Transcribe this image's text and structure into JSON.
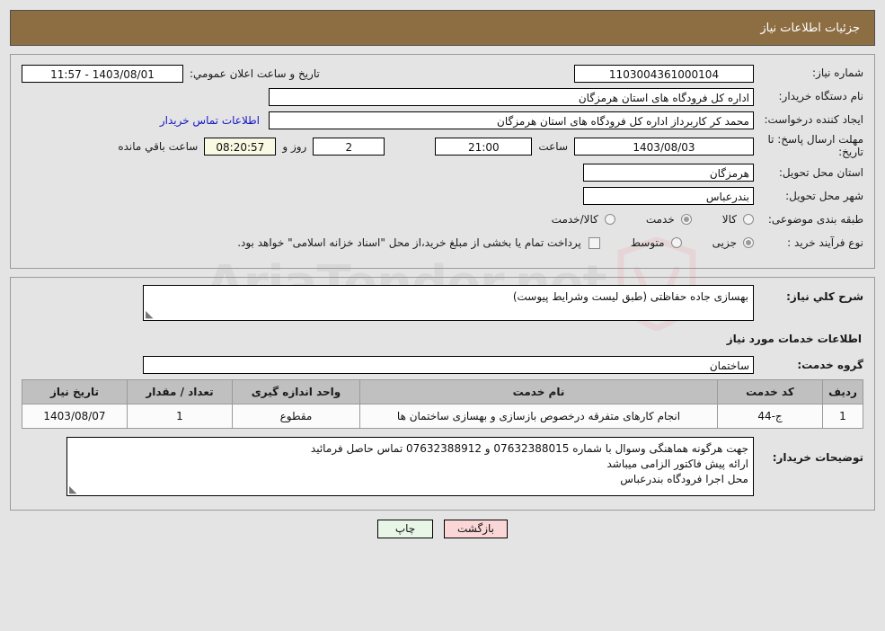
{
  "header": {
    "title": "جزئیات اطلاعات نیاز"
  },
  "watermark": {
    "text": "AriaTender.net",
    "shield_icon": "shield-icon"
  },
  "form": {
    "need_number": {
      "label": "شماره نیاز:",
      "value": "1103004361000104"
    },
    "announce": {
      "label": "تاریخ و ساعت اعلان عمومي:",
      "value": "1403/08/01 - 11:57"
    },
    "buyer_org": {
      "label": "نام دستگاه خریدار:",
      "value": "اداره کل فرودگاه های استان هرمزگان"
    },
    "requester": {
      "label": "ایجاد کننده درخواست:",
      "value": "محمد کر کاربرداز اداره کل فرودگاه های استان هرمزگان"
    },
    "contact_link": {
      "label": "اطلاعات تماس خریدار"
    },
    "deadline": {
      "label": "مهلت ارسال پاسخ: تا تاریخ:",
      "date": "1403/08/03",
      "time_label": "ساعت",
      "time": "21:00",
      "days": "2",
      "days_label": "روز و",
      "countdown": "08:20:57",
      "countdown_label": "ساعت باقي مانده"
    },
    "province": {
      "label": "استان محل تحویل:",
      "value": "هرمزگان"
    },
    "city": {
      "label": "شهر محل تحویل:",
      "value": "بندرعباس"
    },
    "category": {
      "label": "طبقه بندی موضوعی:",
      "options": [
        {
          "label": "کالا",
          "checked": false
        },
        {
          "label": "خدمت",
          "checked": true
        },
        {
          "label": "کالا/خدمت",
          "checked": false
        }
      ]
    },
    "purchase_type": {
      "label": "نوع فرآیند خرید :",
      "options": [
        {
          "label": "جزیی",
          "checked": true
        },
        {
          "label": "متوسط",
          "checked": false
        }
      ],
      "note_checked": false,
      "note": "پرداخت تمام یا بخشی از مبلغ خرید،از محل \"اسناد خزانه اسلامی\" خواهد بود."
    }
  },
  "description": {
    "label": "شرح کلي نیاز:",
    "value": "بهسازی جاده حفاظتی (طبق لیست وشرایط پیوست)"
  },
  "services_section": {
    "title": "اطلاعات خدمات مورد نیاز",
    "group_label": "گروه خدمت:",
    "group_value": "ساختمان"
  },
  "items_table": {
    "columns": [
      "ردیف",
      "کد خدمت",
      "نام خدمت",
      "واحد اندازه گیری",
      "تعداد / مقدار",
      "تاریخ نیاز"
    ],
    "rows": [
      {
        "radif": "1",
        "code": "ج-44",
        "name": "انجام کارهای متفرقه درخصوص بازسازی و بهسازی ساختمان ها",
        "unit": "مقطوع",
        "qty": "1",
        "date": "1403/08/07"
      }
    ]
  },
  "buyer_notes": {
    "label": "توضیحات خریدار:",
    "lines": [
      "جهت هرگونه هماهنگی وسوال با شماره 07632388015 و 07632388912 تماس حاصل فرمائید",
      "ارائه پیش فاکتور الزامی میباشد",
      "محل اجرا فرودگاه بندرعباس"
    ]
  },
  "footer": {
    "print_label": "چاپ",
    "back_label": "بازگشت"
  }
}
